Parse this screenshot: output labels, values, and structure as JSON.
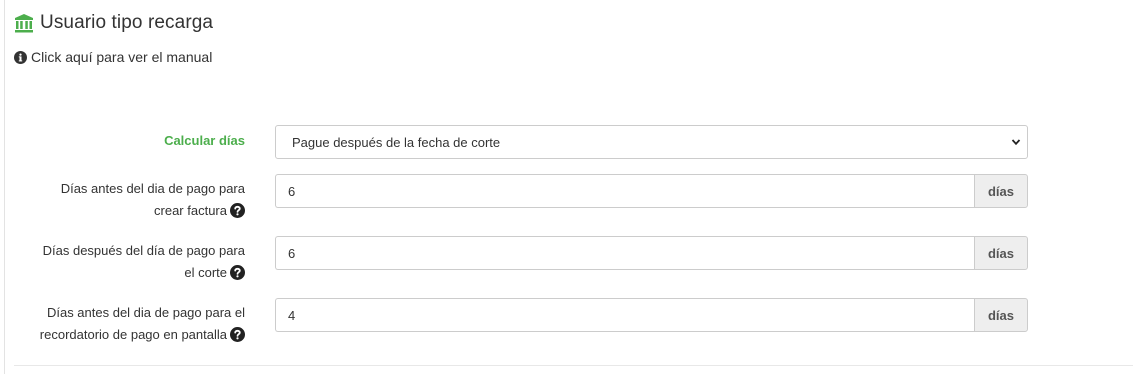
{
  "header": {
    "title": "Usuario tipo recarga",
    "manual_link": "Click aquí para ver el manual"
  },
  "colors": {
    "accent_green": "#4cae4c",
    "text": "#333333",
    "addon_bg": "#eeeeee"
  },
  "form": {
    "calcular_dias": {
      "label": "Calcular días",
      "selected": "Pague después de la fecha de corte"
    },
    "dias_antes_factura": {
      "label_line1": "Días antes del dia de pago para",
      "label_line2": "crear factura",
      "value": "6",
      "addon": "días"
    },
    "dias_despues_corte": {
      "label_line1": "Días después del día de pago para",
      "label_line2": "el corte",
      "value": "6",
      "addon": "días"
    },
    "dias_antes_recordatorio": {
      "label_line1": "Días antes del dia de pago para el",
      "label_line2": "recordatorio de pago en pantalla",
      "value": "4",
      "addon": "días"
    }
  }
}
